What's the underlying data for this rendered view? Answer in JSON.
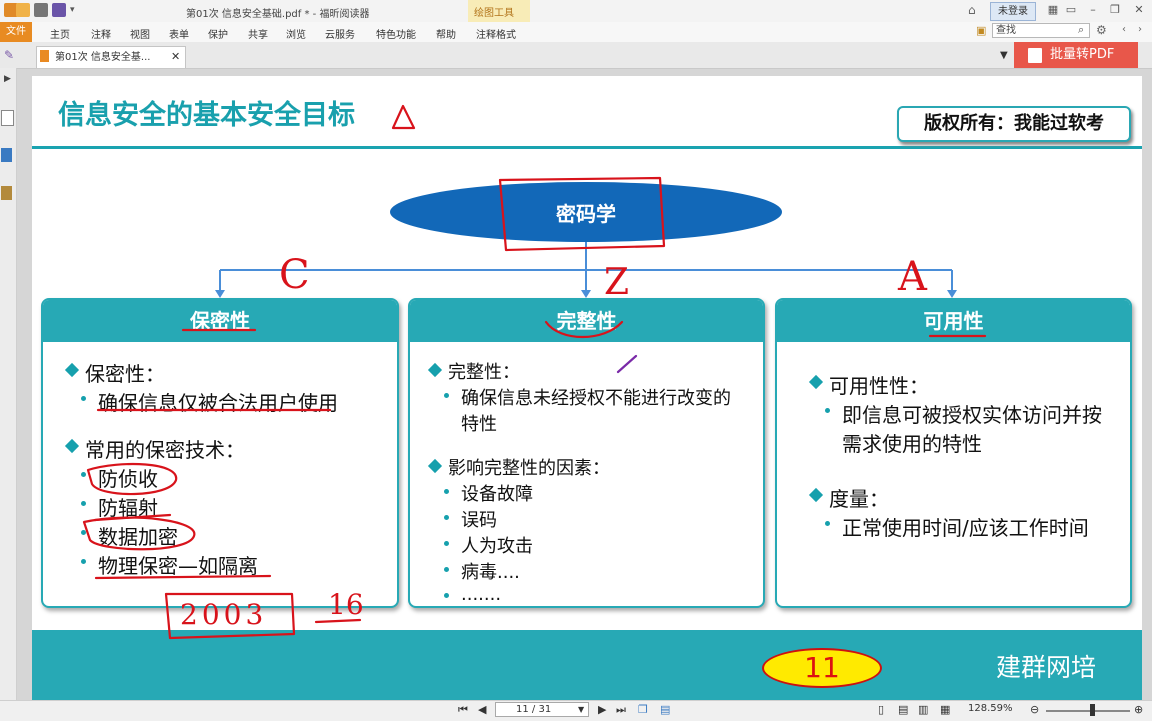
{
  "window": {
    "title": "第01次 信息安全基础.pdf * - 福昕阅读器",
    "context_tool": "绘图工具",
    "login": "未登录"
  },
  "menu": {
    "file": "文件",
    "items": [
      "主页",
      "注释",
      "视图",
      "表单",
      "保护",
      "共享",
      "浏览",
      "云服务",
      "特色功能",
      "帮助",
      "注释格式"
    ]
  },
  "search": {
    "placeholder": "查找"
  },
  "tab": {
    "label": "第01次 信息安全基..."
  },
  "convert_button": "批量转PDF",
  "slide": {
    "title": "信息安全的基本安全目标",
    "copyright": "版权所有：我能过软考",
    "center": "密码学",
    "org": "建群网培",
    "page_badge": "11",
    "cards": [
      {
        "header": "保密性",
        "sections": [
          {
            "head": "保密性：",
            "items": [
              "确保信息仅被合法用户使用"
            ]
          },
          {
            "head": "常用的保密技术：",
            "items": [
              "防侦收",
              "防辐射",
              "数据加密",
              "物理保密—如隔离"
            ]
          }
        ]
      },
      {
        "header": "完整性",
        "sections": [
          {
            "head": "完整性：",
            "items": [
              "确保信息未经授权不能进行改变的特性"
            ]
          },
          {
            "head": "影响完整性的因素：",
            "items": [
              "设备故障",
              "误码",
              "人为攻击",
              "病毒....",
              "......."
            ]
          }
        ]
      },
      {
        "header": "可用性",
        "sections": [
          {
            "head": "可用性性：",
            "items": [
              "即信息可被授权实体访问并按需求使用的特性"
            ]
          },
          {
            "head": "度量：",
            "items": [
              "正常使用时间/应该工作时间"
            ]
          }
        ]
      }
    ],
    "annotations": {
      "c": "C",
      "z": "Z",
      "a": "A",
      "year": "2003",
      "num": "16"
    }
  },
  "statusbar": {
    "page": "11 / 31",
    "zoom": "128.59%"
  },
  "colors": {
    "teal": "#27a9b5",
    "blue": "#1268b8",
    "ink_red": "#d8131b",
    "accent_orange": "#e88b22"
  },
  "icons": [
    "save-icon",
    "print-icon",
    "open-icon",
    "search-icon",
    "gear-icon",
    "first-page-icon",
    "prev-page-icon",
    "next-page-icon",
    "last-page-icon",
    "zoom-in-icon",
    "zoom-out-icon"
  ]
}
